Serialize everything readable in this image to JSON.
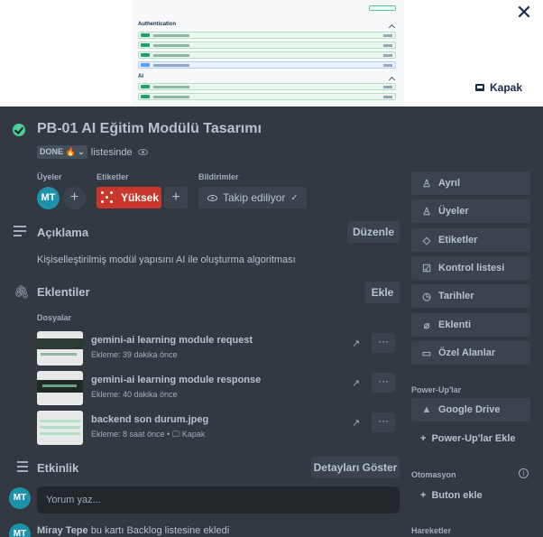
{
  "cover": {
    "preview_heading_1": "Authentication",
    "preview_heading_2": "AI",
    "cover_button_label": "Kapak"
  },
  "card": {
    "title": "PB-01 AI Eğitim Modülü Tasarımı",
    "list_badge": "DONE 🔥",
    "list_suffix": "listesinde"
  },
  "members": {
    "label": "Üyeler",
    "avatar_initials": "MT"
  },
  "labels": {
    "label": "Etiketler",
    "chip_text": "Yüksek",
    "chip_color": "#c9372c"
  },
  "notifications": {
    "label": "Bildirimler",
    "watch_label": "Takip ediliyor"
  },
  "description": {
    "title": "Açıklama",
    "edit_button": "Düzenle",
    "text": "Kişiselleştirilmiş modül yapısını AI ile oluşturma algoritması"
  },
  "attachments": {
    "title": "Eklentiler",
    "add_button": "Ekle",
    "files_label": "Dosyalar",
    "items": [
      {
        "name": "gemini-ai learning module request",
        "meta": "Ekleme: 39 dakika önce"
      },
      {
        "name": "gemini-ai learning module response",
        "meta": "Ekleme: 40 dakika önce"
      },
      {
        "name": "backend son durum.jpeg",
        "meta": "Ekleme: 8 saat önce • ",
        "cover_tag": "Kapak"
      }
    ]
  },
  "activity": {
    "title": "Etkinlik",
    "details_button": "Detayları Göster",
    "comment_placeholder": "Yorum yaz...",
    "log_user": "Miray Tepe",
    "log_text": " bu kartı Backlog listesine ekledi"
  },
  "sidebar": {
    "items": [
      {
        "label": "Ayrıl",
        "icon": "person-icon"
      },
      {
        "label": "Üyeler",
        "icon": "person-icon"
      },
      {
        "label": "Etiketler",
        "icon": "tag-icon"
      },
      {
        "label": "Kontrol listesi",
        "icon": "checklist-icon"
      },
      {
        "label": "Tarihler",
        "icon": "clock-icon"
      },
      {
        "label": "Eklenti",
        "icon": "paperclip-icon"
      },
      {
        "label": "Özel Alanlar",
        "icon": "fields-icon"
      }
    ],
    "powerups_label": "Power-Up'lar",
    "google_drive": "Google Drive",
    "add_powerup": "Power-Up'lar Ekle",
    "automation_label": "Otomasyon",
    "add_button": "Buton ekle",
    "actions_label": "Hareketler"
  }
}
